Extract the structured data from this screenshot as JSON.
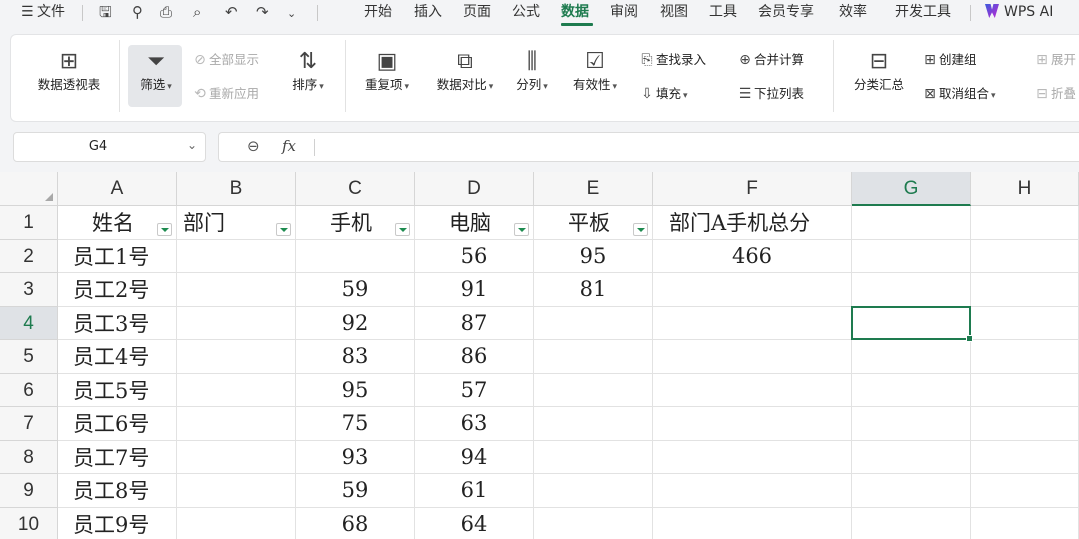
{
  "menubar": {
    "file_label": "文件",
    "tabs": [
      {
        "label": "开始"
      },
      {
        "label": "插入"
      },
      {
        "label": "页面"
      },
      {
        "label": "公式"
      },
      {
        "label": "数据",
        "active": true
      },
      {
        "label": "审阅"
      },
      {
        "label": "视图"
      },
      {
        "label": "工具"
      },
      {
        "label": "会员专享"
      },
      {
        "label": "效率"
      },
      {
        "label": "开发工具"
      }
    ],
    "ai_label": "WPS AI",
    "quick_access_icons": [
      "save-icon",
      "format-painter-icon",
      "print-icon",
      "print-preview-icon",
      "undo-icon",
      "redo-icon",
      "more-icon"
    ],
    "accent_color": "#1e7b4f"
  },
  "ribbon": {
    "pivot_table": "数据透视表",
    "filter": "筛选",
    "show_all": "全部显示",
    "reapply": "重新应用",
    "sort": "排序",
    "duplicates": "重复项",
    "compare": "数据对比",
    "split_column": "分列",
    "validity": "有效性",
    "find_entry": "查找录入",
    "fill": "填充",
    "merge_calc": "合并计算",
    "dropdown_list": "下拉列表",
    "subtotal": "分类汇总",
    "create_group": "创建组",
    "ungroup": "取消组合",
    "expand": "展开",
    "collapse": "折叠"
  },
  "formula_bar": {
    "cell_ref": "G4",
    "fx_label": "fx",
    "formula": ""
  },
  "sheet": {
    "columns": [
      "A",
      "B",
      "C",
      "D",
      "E",
      "F",
      "G",
      "H"
    ],
    "selected_column": "G",
    "selected_row": "4",
    "selected_cell": "G4",
    "rows": [
      {
        "num": "1",
        "A": "姓名",
        "B": "部门",
        "C": "手机",
        "D": "电脑",
        "E": "平板",
        "F": "部门A手机总分",
        "G": "",
        "H": ""
      },
      {
        "num": "2",
        "A": "员工1号",
        "B": "",
        "C": "",
        "D": "56",
        "E": "95",
        "F": "466",
        "G": "",
        "H": ""
      },
      {
        "num": "3",
        "A": "员工2号",
        "B": "",
        "C": "59",
        "D": "91",
        "E": "81",
        "F": "",
        "G": "",
        "H": ""
      },
      {
        "num": "4",
        "A": "员工3号",
        "B": "",
        "C": "92",
        "D": "87",
        "E": "",
        "F": "",
        "G": "",
        "H": ""
      },
      {
        "num": "5",
        "A": "员工4号",
        "B": "",
        "C": "83",
        "D": "86",
        "E": "",
        "F": "",
        "G": "",
        "H": ""
      },
      {
        "num": "6",
        "A": "员工5号",
        "B": "",
        "C": "95",
        "D": "57",
        "E": "",
        "F": "",
        "G": "",
        "H": ""
      },
      {
        "num": "7",
        "A": "员工6号",
        "B": "",
        "C": "75",
        "D": "63",
        "E": "",
        "F": "",
        "G": "",
        "H": ""
      },
      {
        "num": "8",
        "A": "员工7号",
        "B": "",
        "C": "93",
        "D": "94",
        "E": "",
        "F": "",
        "G": "",
        "H": ""
      },
      {
        "num": "9",
        "A": "员工8号",
        "B": "",
        "C": "59",
        "D": "61",
        "E": "",
        "F": "",
        "G": "",
        "H": ""
      },
      {
        "num": "10",
        "A": "员工9号",
        "B": "",
        "C": "68",
        "D": "64",
        "E": "",
        "F": "",
        "G": "",
        "H": ""
      }
    ]
  }
}
